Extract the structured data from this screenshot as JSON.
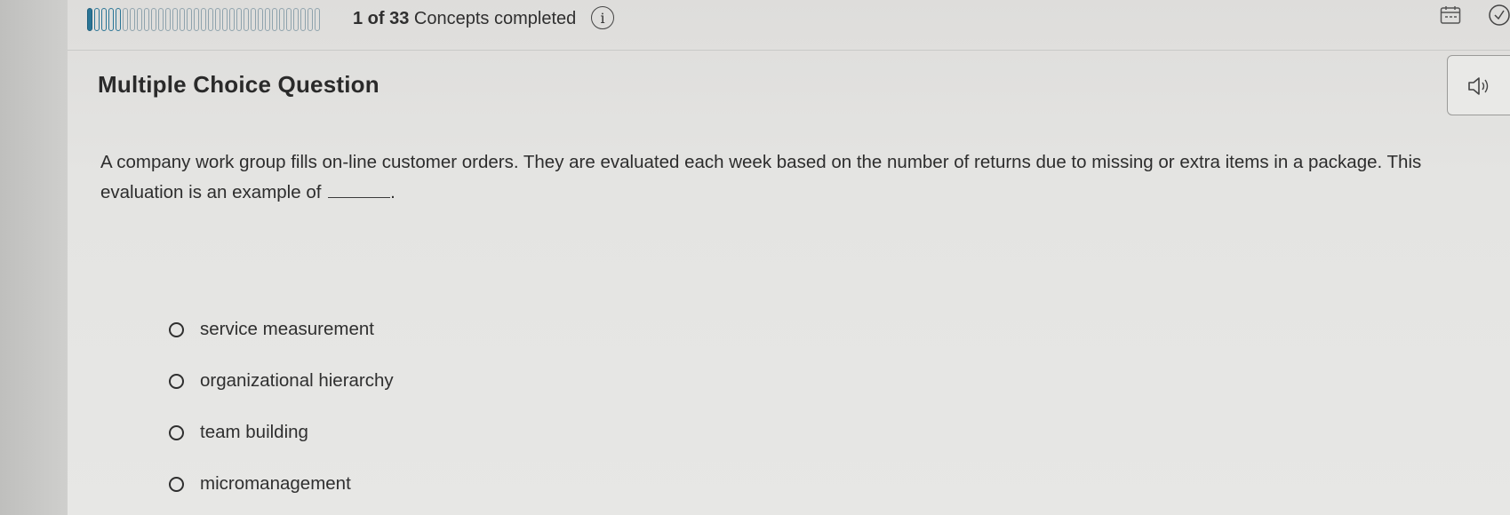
{
  "progress": {
    "completed": 1,
    "total": 33,
    "count_text": "1 of 33",
    "status_text": "Concepts completed",
    "accent_color": "#2a7596"
  },
  "info": {
    "icon": "info-icon",
    "glyph": "i"
  },
  "toolbar": {
    "calendar_icon": "calendar-icon",
    "check_icon": "check-circle-icon"
  },
  "question": {
    "heading": "Multiple Choice Question",
    "text_before_blank": "A company work group fills on-line customer orders. They are evaluated each week based on the number of returns due to missing or extra items in a package. This evaluation is an example of ",
    "text_after_blank": ".",
    "audio_icon": "speaker-icon"
  },
  "options": [
    {
      "label": "service measurement",
      "selected": false
    },
    {
      "label": "organizational hierarchy",
      "selected": false
    },
    {
      "label": "team building",
      "selected": false
    },
    {
      "label": "micromanagement",
      "selected": false
    }
  ]
}
